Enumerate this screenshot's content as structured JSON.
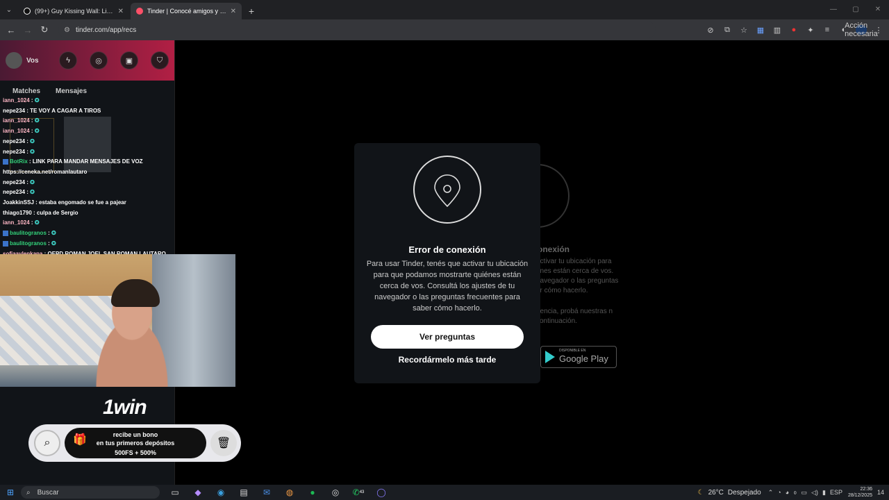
{
  "browser": {
    "tabs": [
      {
        "label": "(99+) Guy Kissing Wall: Licking I",
        "active": false
      },
      {
        "label": "Tinder | Conocé amigos y gente",
        "active": true
      }
    ],
    "url": "tinder.com/app/recs",
    "action_label": "Acción necesaria"
  },
  "sidebar": {
    "user_label": "Vos",
    "tabs": [
      "Matches",
      "Mensajes"
    ]
  },
  "chat": [
    {
      "user": "iann_1024",
      "text": "",
      "cls": "u1",
      "emote": true
    },
    {
      "user": "nepe234",
      "text": "TE VOY A CAGAR A TIROS",
      "cls": "u2",
      "emote": false
    },
    {
      "user": "iann_1024",
      "text": "",
      "cls": "u1",
      "emote": true
    },
    {
      "user": "iann_1024",
      "text": "",
      "cls": "u1",
      "emote": true
    },
    {
      "user": "nepe234",
      "text": "",
      "cls": "u2",
      "emote": true
    },
    {
      "user": "nepe234",
      "text": "",
      "cls": "u2",
      "emote": true
    },
    {
      "user": "BotRix",
      "text": "LINK PARA MANDAR MENSAJES DE VOZ",
      "cls": "u3",
      "emote": false,
      "badge": true
    },
    {
      "user": "",
      "text": "https://ceneka.net/romanlautaro",
      "cls": "u2",
      "emote": false
    },
    {
      "user": "nepe234",
      "text": "",
      "cls": "u2",
      "emote": true
    },
    {
      "user": "nepe234",
      "text": "",
      "cls": "u2",
      "emote": true
    },
    {
      "user": "JoakkinSSJ",
      "text": "estaba engomado se fue a pajear",
      "cls": "u2",
      "emote": false
    },
    {
      "user": "thiago1790",
      "text": "culpa de Sergio",
      "cls": "u2",
      "emote": false
    },
    {
      "user": "iann_1024",
      "text": "",
      "cls": "u1",
      "emote": true
    },
    {
      "user": "baulitogranos",
      "text": "",
      "cls": "u3",
      "emote": true,
      "badge": true
    },
    {
      "user": "baulitogranos",
      "text": "",
      "cls": "u3",
      "emote": true,
      "badge": true
    },
    {
      "user": "sofiaaylenkapa",
      "text": "QEPD ROMAN JOEL SAN ROMAN LAUTARO",
      "cls": "u1",
      "emote": false
    }
  ],
  "ad": {
    "brand": "1win",
    "line1": "recibe un bono",
    "line2": "en tus primeros depósitos",
    "line3": "500FS + 500%"
  },
  "modal": {
    "title": "Error de conexión",
    "text": "Para usar Tinder, tenés que activar tu ubicación para que podamos mostrarte quiénes están cerca de vos. Consultá los ajustes de tu navegador o las preguntas frecuentes para saber cómo hacerlo.",
    "primary_button": "Ver preguntas",
    "secondary_button": "Recordármelo más tarde"
  },
  "background_panel": {
    "title": "onexión",
    "text1": "activar tu ubicación para énes están cerca de vos. navegador o las preguntas er cómo hacerlo.",
    "text2": "riencia, probá nuestras n continuación.",
    "store_small": "DISPONIBLE EN",
    "store_big": "Google Play"
  },
  "taskbar": {
    "search_label": "Buscar",
    "temperature": "26°C",
    "weather": "Despejado",
    "lang": "ESP",
    "time": "22:36",
    "date": "28/12/2025",
    "whatsapp_badge": "43",
    "notif_count": "14"
  }
}
